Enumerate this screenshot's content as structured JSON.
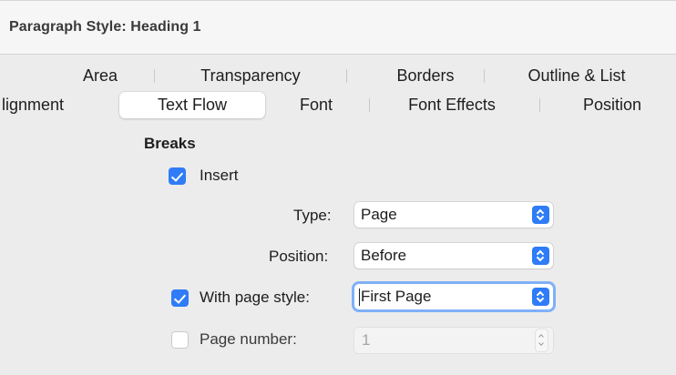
{
  "window": {
    "title": "Paragraph Style: Heading 1"
  },
  "tabs": {
    "row1": [
      "Area",
      "Transparency",
      "Borders",
      "Outline & List"
    ],
    "row2": [
      "lignment",
      "Text Flow",
      "Font",
      "Font Effects",
      "Position"
    ],
    "active": "Text Flow"
  },
  "breaks": {
    "section_title": "Breaks",
    "insert": {
      "label": "Insert",
      "checked": true
    },
    "type": {
      "label": "Type:",
      "value": "Page"
    },
    "position": {
      "label": "Position:",
      "value": "Before"
    },
    "with_page_style": {
      "label": "With page style:",
      "checked": true,
      "value": "First Page"
    },
    "page_number": {
      "label": "Page number:",
      "checked": false,
      "value": "1"
    }
  },
  "colors": {
    "accent": "#2f7cf6",
    "tab_bar_bg": "#ececec",
    "title_bg": "#f6f6f6"
  }
}
